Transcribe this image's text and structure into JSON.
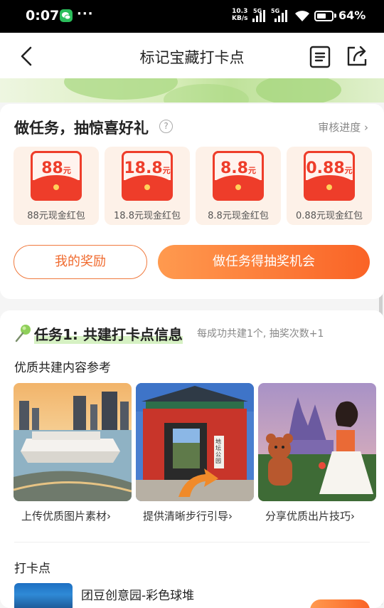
{
  "status_bar": {
    "time": "0:07",
    "more": "···",
    "speed_value": "10.3",
    "speed_unit": "KB/s",
    "network1": "5G",
    "network2": "5G",
    "battery_percent": "64%",
    "battery_level": 0.64
  },
  "nav": {
    "title": "标记宝藏打卡点",
    "back_icon": "chevron-left-icon",
    "doc_icon": "document-icon",
    "share_icon": "share-icon"
  },
  "draw": {
    "section_title": "做任务，抽惊喜好礼",
    "help_mark": "?",
    "audit_link": "审核进度",
    "chevron": "›",
    "prizes": [
      {
        "amount": "88",
        "unit": "元",
        "label": "88元现金红包"
      },
      {
        "amount": "18.8",
        "unit": "元",
        "label": "18.8元现金红包"
      },
      {
        "amount": "8.8",
        "unit": "元",
        "label": "8.8元现金红包"
      },
      {
        "amount": "0.88",
        "unit": "元",
        "label": "0.88元现金红包"
      }
    ],
    "my_rewards_button": "我的奖励",
    "do_task_button": "做任务得抽奖机会"
  },
  "task1": {
    "title": "任务1: 共建打卡点信息",
    "subtitle": "每成功共建1个, 抽奖次数+1",
    "reference_title": "优质共建内容参考",
    "references": [
      {
        "caption": "上传优质图片素材"
      },
      {
        "caption": "提供清晰步行引导"
      },
      {
        "caption": "分享优质出片技巧"
      }
    ],
    "sign_text": "地坛公园",
    "checkin_title": "打卡点",
    "poi_name": "团豆创意园-彩色球堆"
  },
  "colors": {
    "accent": "#fa6326",
    "accent_light": "#ff9a4f",
    "envelope_red": "#ee3d2a",
    "prize_bg": "#fdf1e8",
    "text_gray": "#888888"
  }
}
